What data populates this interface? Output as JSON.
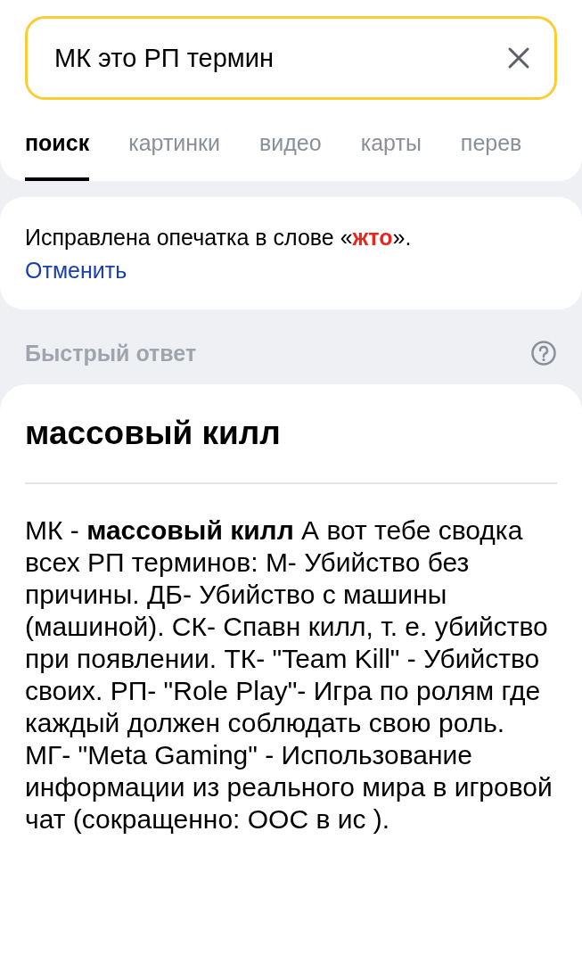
{
  "search": {
    "value": "МК это РП термин"
  },
  "tabs": [
    {
      "label": "поиск",
      "selected": true
    },
    {
      "label": "картинки",
      "selected": false
    },
    {
      "label": "видео",
      "selected": false
    },
    {
      "label": "карты",
      "selected": false
    },
    {
      "label": "перев",
      "selected": false
    }
  ],
  "correction": {
    "text": "Исправлена опечатка в слове «**жто**».",
    "link": "Отменить"
  },
  "quick_answer": {
    "label": "Быстрый ответ",
    "title": "массовый килл",
    "text": "МК - **массовый килл** А вот тебе сводка всех РП терминов: М- Убийство без причины. ДБ- Убийство с машины (машиной). СК- Спавн килл, т. е. убийство при появлении. ТК- \"Team Kill\" - Убийство своих. РП- \"Role Play\"- Игра по ролям где каждый должен соблюдать свою роль. МГ- \"Meta Gaming\" - Использование информации из реального мира в игровой чат (сокращенно: ООС в ис )."
  }
}
